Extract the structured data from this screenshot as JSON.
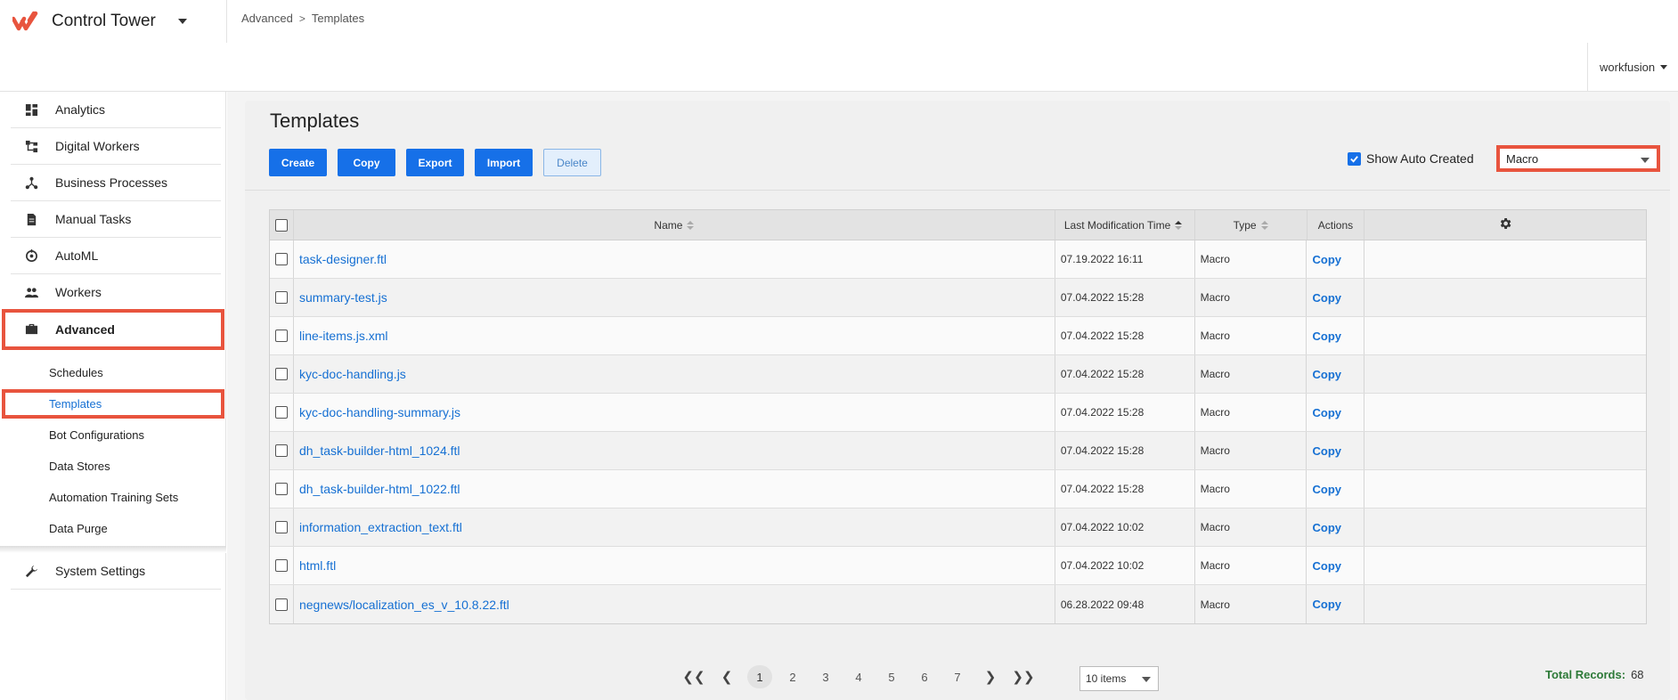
{
  "app": {
    "title": "Control Tower",
    "user": "workfusion",
    "brand_color": "#e8543e",
    "accent_color": "#1670e8"
  },
  "breadcrumb": {
    "items": [
      "Advanced",
      "Templates"
    ],
    "separator": ">"
  },
  "sidebar": {
    "items": [
      {
        "label": "Analytics",
        "icon": "dashboard-icon"
      },
      {
        "label": "Digital Workers",
        "icon": "workflow-icon"
      },
      {
        "label": "Business Processes",
        "icon": "process-icon"
      },
      {
        "label": "Manual Tasks",
        "icon": "document-icon"
      },
      {
        "label": "AutoML",
        "icon": "automl-icon"
      },
      {
        "label": "Workers",
        "icon": "people-icon"
      },
      {
        "label": "Advanced",
        "icon": "briefcase-icon",
        "active": true
      },
      {
        "label": "System Settings",
        "icon": "wrench-icon"
      }
    ],
    "subitems": [
      {
        "label": "Schedules"
      },
      {
        "label": "Templates",
        "active": true
      },
      {
        "label": "Bot Configurations"
      },
      {
        "label": "Data Stores"
      },
      {
        "label": "Automation Training Sets"
      },
      {
        "label": "Data Purge"
      }
    ]
  },
  "page": {
    "title": "Templates",
    "buttons": {
      "create": "Create",
      "copy": "Copy",
      "export": "Export",
      "import": "Import",
      "delete": "Delete"
    },
    "show_auto_created": {
      "label": "Show Auto Created",
      "checked": true
    },
    "type_filter": {
      "selected": "Macro"
    }
  },
  "table": {
    "columns": {
      "name": "Name",
      "time": "Last Modification Time",
      "type": "Type",
      "actions": "Actions"
    },
    "rows": [
      {
        "name": "task-designer.ftl",
        "time": "07.19.2022 16:11",
        "type": "Macro",
        "action": "Copy"
      },
      {
        "name": "summary-test.js",
        "time": "07.04.2022 15:28",
        "type": "Macro",
        "action": "Copy"
      },
      {
        "name": "line-items.js.xml",
        "time": "07.04.2022 15:28",
        "type": "Macro",
        "action": "Copy"
      },
      {
        "name": "kyc-doc-handling.js",
        "time": "07.04.2022 15:28",
        "type": "Macro",
        "action": "Copy"
      },
      {
        "name": "kyc-doc-handling-summary.js",
        "time": "07.04.2022 15:28",
        "type": "Macro",
        "action": "Copy"
      },
      {
        "name": "dh_task-builder-html_1024.ftl",
        "time": "07.04.2022 15:28",
        "type": "Macro",
        "action": "Copy"
      },
      {
        "name": "dh_task-builder-html_1022.ftl",
        "time": "07.04.2022 15:28",
        "type": "Macro",
        "action": "Copy"
      },
      {
        "name": "information_extraction_text.ftl",
        "time": "07.04.2022 10:02",
        "type": "Macro",
        "action": "Copy"
      },
      {
        "name": "html.ftl",
        "time": "07.04.2022 10:02",
        "type": "Macro",
        "action": "Copy"
      },
      {
        "name": "negnews/localization_es_v_10.8.22.ftl",
        "time": "06.28.2022 09:48",
        "type": "Macro",
        "action": "Copy"
      }
    ]
  },
  "pagination": {
    "first": "❮❮",
    "prev": "❮",
    "pages": [
      "1",
      "2",
      "3",
      "4",
      "5",
      "6",
      "7"
    ],
    "current": "1",
    "next": "❯",
    "last": "❯❯",
    "per_page": "10 items",
    "total_label": "Total Records:",
    "total_value": "68"
  }
}
